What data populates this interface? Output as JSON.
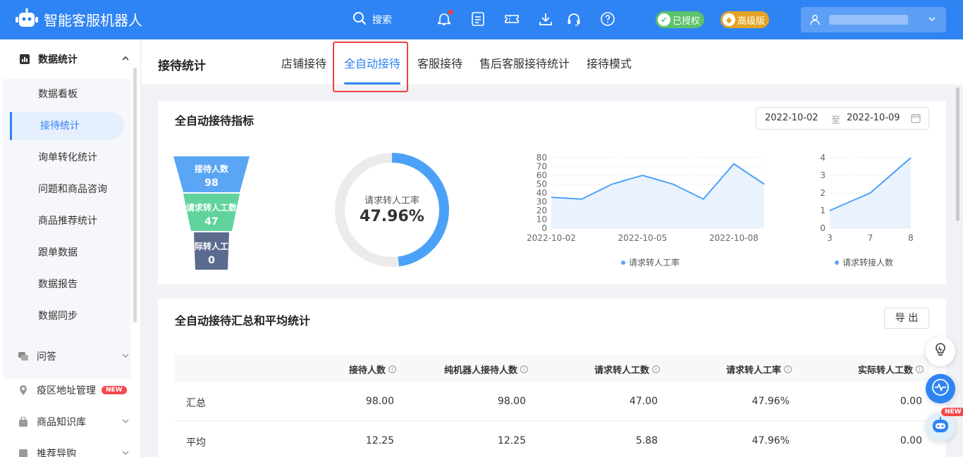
{
  "app": {
    "title": "智能客服机器人"
  },
  "topbar": {
    "search_label": "搜索",
    "authorized_label": "已授权",
    "tier_label": "高级版",
    "icons": [
      "bell-icon",
      "list-icon",
      "ticket-icon",
      "download-icon",
      "headset-icon",
      "help-icon"
    ]
  },
  "sidebar": {
    "group_label": "数据统计",
    "sub_items": [
      {
        "label": "数据看板"
      },
      {
        "label": "接待统计",
        "active": true
      },
      {
        "label": "询单转化统计"
      },
      {
        "label": "问题和商品咨询"
      },
      {
        "label": "商品推荐统计"
      },
      {
        "label": "跟单数据"
      },
      {
        "label": "数据报告"
      },
      {
        "label": "数据同步"
      }
    ],
    "main_items": [
      {
        "label": "问答"
      },
      {
        "label": "疫区地址管理",
        "tag": "NEW"
      },
      {
        "label": "商品知识库"
      },
      {
        "label": "推荐导购"
      }
    ]
  },
  "header": {
    "title": "接待统计",
    "tabs": [
      {
        "label": "店铺接待"
      },
      {
        "label": "全自动接待",
        "active": true
      },
      {
        "label": "客服接待"
      },
      {
        "label": "售后客服接待统计"
      },
      {
        "label": "接待模式"
      }
    ]
  },
  "metrics_card": {
    "title": "全自动接待指标",
    "date_from": "2022-10-02",
    "date_sep": "至",
    "date_to": "2022-10-09",
    "funnel": [
      {
        "label": "接待人数",
        "value": "98",
        "color": "#5aa6f5"
      },
      {
        "label": "请求转人工数",
        "value": "47",
        "color": "#5fd39b"
      },
      {
        "label": "实际转人工数",
        "value": "0",
        "color": "#5b6b8f"
      }
    ],
    "donut": {
      "label": "请求转人工率",
      "value": "47.96%",
      "fraction": 0.4796,
      "color": "#4ba1f8",
      "track": "#ebebeb"
    }
  },
  "chart_data": [
    {
      "type": "area",
      "x": [
        "2022-10-02",
        "2022-10-03",
        "2022-10-04",
        "2022-10-05",
        "2022-10-06",
        "2022-10-07",
        "2022-10-08",
        "2022-10-09"
      ],
      "xticks": [
        "2022-10-02",
        "2022-10-05",
        "2022-10-08"
      ],
      "series": [
        {
          "name": "请求转人工率",
          "values": [
            35,
            33,
            50,
            60,
            50,
            33,
            73,
            50
          ]
        }
      ],
      "ylim": [
        0,
        80
      ],
      "yticks": [
        0,
        10,
        20,
        30,
        40,
        50,
        60,
        70,
        80
      ],
      "grid": true,
      "legend": "bottom"
    },
    {
      "type": "area",
      "x": [
        3,
        7,
        8
      ],
      "xticks": [
        "3",
        "7",
        "8"
      ],
      "series": [
        {
          "name": "请求转接人数",
          "values": [
            1,
            2,
            4
          ]
        }
      ],
      "ylim": [
        0,
        4
      ],
      "yticks": [
        0,
        1,
        2,
        3,
        4
      ],
      "grid": true,
      "legend": "bottom"
    }
  ],
  "summary_card": {
    "title": "全自动接待汇总和平均统计",
    "export_label": "导 出",
    "columns": [
      "接待人数",
      "纯机器人接待人数",
      "请求转人工数",
      "请求转人工率",
      "实际转人工数"
    ],
    "rows": [
      {
        "name": "汇总",
        "cells": [
          "98.00",
          "98.00",
          "47.00",
          "47.96%",
          "0.00"
        ]
      },
      {
        "name": "平均",
        "cells": [
          "12.25",
          "12.25",
          "5.88",
          "47.96%",
          "0.00"
        ]
      }
    ]
  },
  "floaters": {
    "new_label": "NEW"
  }
}
